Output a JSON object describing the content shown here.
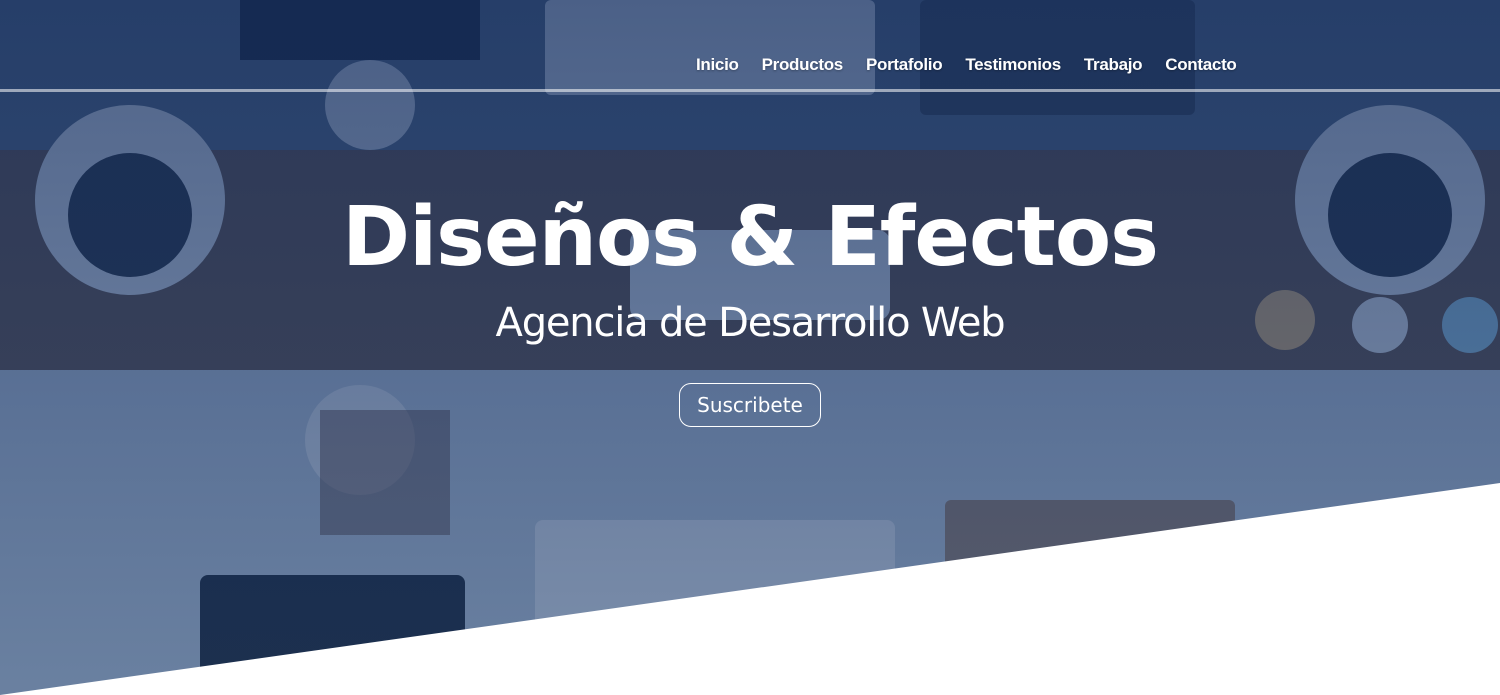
{
  "nav": {
    "items": [
      "Inicio",
      "Productos",
      "Portafolio",
      "Testimonios",
      "Trabajo",
      "Contacto"
    ]
  },
  "hero": {
    "title": "Diseños & Efectos",
    "subtitle": "Agencia de Desarrollo Web",
    "cta_label": "Suscribete"
  },
  "colors": {
    "overlay": "#1e3a6e",
    "text": "#ffffff",
    "slant": "#ffffff"
  }
}
